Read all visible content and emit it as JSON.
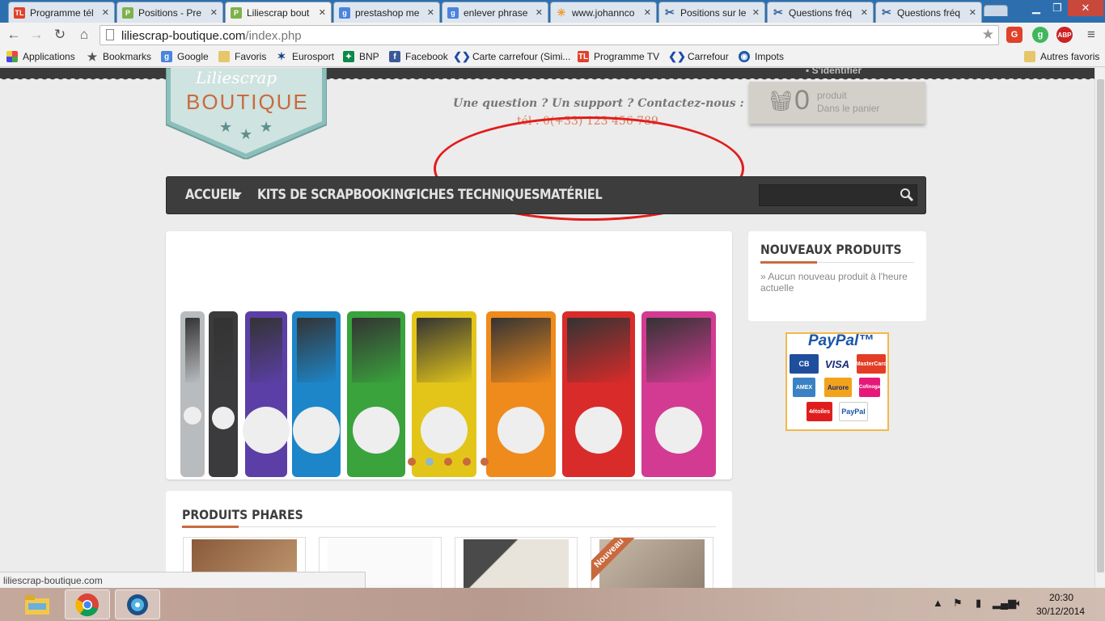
{
  "browser": {
    "tabs": [
      {
        "label": "Programme tél",
        "favicon": "tl-icon",
        "color": "#e0412a"
      },
      {
        "label": "Positions - Pre",
        "favicon": "prestashop-icon",
        "color": "#7db24b"
      },
      {
        "label": "Liliescrap bout",
        "favicon": "prestashop-icon",
        "color": "#7db24b"
      },
      {
        "label": "prestashop me",
        "favicon": "google-icon",
        "color": "#4a84de"
      },
      {
        "label": "enlever phrase",
        "favicon": "google-icon",
        "color": "#4a84de"
      },
      {
        "label": "www.johannco",
        "favicon": "loading-icon",
        "color": "#f39b2d"
      },
      {
        "label": "Positions sur le",
        "favicon": "scissors-icon",
        "color": "#3d5f9a"
      },
      {
        "label": "Questions fréq",
        "favicon": "scissors-icon",
        "color": "#3d5f9a"
      },
      {
        "label": "Questions fréq",
        "favicon": "scissors-icon",
        "color": "#3d5f9a"
      }
    ],
    "address": {
      "domain": "liliescrap-boutique.com",
      "path": "/index.php"
    },
    "bookmarks": [
      {
        "label": "Applications",
        "icon": "apps-grid-icon"
      },
      {
        "label": "Bookmarks",
        "icon": "star-icon"
      },
      {
        "label": "Google",
        "icon": "google-icon"
      },
      {
        "label": "Favoris",
        "icon": "folder-icon"
      },
      {
        "label": "Eurosport",
        "icon": "eurosport-icon"
      },
      {
        "label": "BNP",
        "icon": "bnp-icon"
      },
      {
        "label": "Facebook",
        "icon": "facebook-icon"
      },
      {
        "label": "Carte carrefour (Simi...",
        "icon": "carrefour-icon"
      },
      {
        "label": "Programme TV",
        "icon": "tl-icon"
      },
      {
        "label": "Carrefour",
        "icon": "carrefour-icon"
      },
      {
        "label": "Impots",
        "icon": "impots-icon"
      }
    ],
    "other_bookmarks": "Autres favoris",
    "status_url": "liliescrap-boutique.com"
  },
  "site": {
    "signin": "S'identifier",
    "logo_script": "Liliescrap",
    "logo_word": "BOUTIQUE",
    "contact_line": "Une question ? Un support ? Contactez-nous :",
    "contact_phone": "tél : 0(+33) 123 456 789",
    "cart": {
      "count": "0",
      "line1": "produit",
      "line2": "Dans le panier"
    },
    "nav": [
      "ACCUEIL",
      "KITS DE SCRAPBOOKING",
      "FICHES TECHNIQUES",
      "MATÉRIEL"
    ],
    "search_placeholder": "",
    "slider": {
      "ipod_colors": [
        "#b9bcbf",
        "#3b3b3d",
        "#5b3fa6",
        "#1d86c9",
        "#3aa33c",
        "#e3c51a",
        "#ef8a1c",
        "#d92b2a",
        "#d33b93"
      ],
      "dots": 5,
      "active_dot": 2
    },
    "new_products": {
      "title": "NOUVEAUX PRODUITS",
      "text": "» Aucun nouveau produit à l'heure actuelle"
    },
    "paypal": {
      "logo": "PayPal™",
      "cards": [
        "CB",
        "VISA",
        "MasterCard",
        "AMEX",
        "Aurore",
        "Cofinoga",
        "4étoiles",
        "PayPal"
      ]
    },
    "featured": {
      "title": "PRODUITS PHARES",
      "badge": "Nouveau"
    }
  },
  "taskbar": {
    "apps": [
      "file-explorer-icon",
      "chrome-icon",
      "media-icon"
    ],
    "time": "20:30",
    "date": "30/12/2014"
  },
  "colors": {
    "accent": "#c96a3e",
    "logo_teal": "#8cbfbb",
    "annotation": "#e21c1c",
    "nav_bg": "#3d3d3d"
  }
}
